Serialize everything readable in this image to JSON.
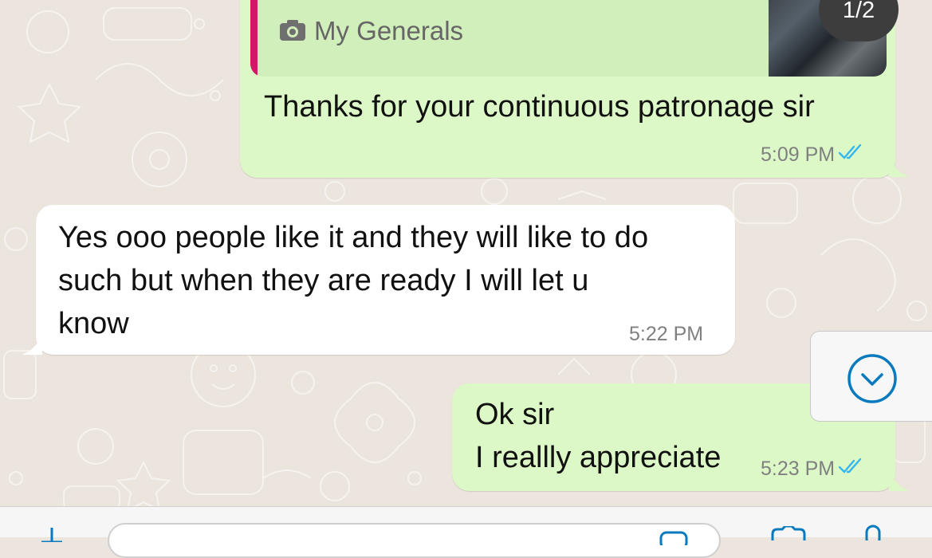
{
  "quote": {
    "label": "My Generals",
    "counter": "1/2"
  },
  "messages": [
    {
      "direction": "outgoing",
      "lines": [
        "Thanks for your continuous patronage sir"
      ],
      "time": "5:09 PM",
      "status": "read"
    },
    {
      "direction": "incoming",
      "lines": [
        "Yes ooo people like it and they will like to do",
        "such but when they are ready I will let u",
        "know"
      ],
      "time": "5:22 PM"
    },
    {
      "direction": "outgoing",
      "lines": [
        "Ok sir",
        "I reallly appreciate"
      ],
      "time": "5:23 PM",
      "status": "read"
    }
  ],
  "icons": {
    "camera": "camera-icon",
    "read_ticks": "double-check-icon",
    "scroll_down": "chevron-down-icon",
    "attach": "plus-icon",
    "sticker": "sticker-icon",
    "camera_bar": "camera-icon",
    "mic": "mic-icon"
  },
  "colors": {
    "outgoing_bubble": "#dcf8c6",
    "incoming_bubble": "#ffffff",
    "quote_accent": "#d6166b",
    "read_ticks": "#34b7f1",
    "scroll_button": "#0a7abf"
  }
}
